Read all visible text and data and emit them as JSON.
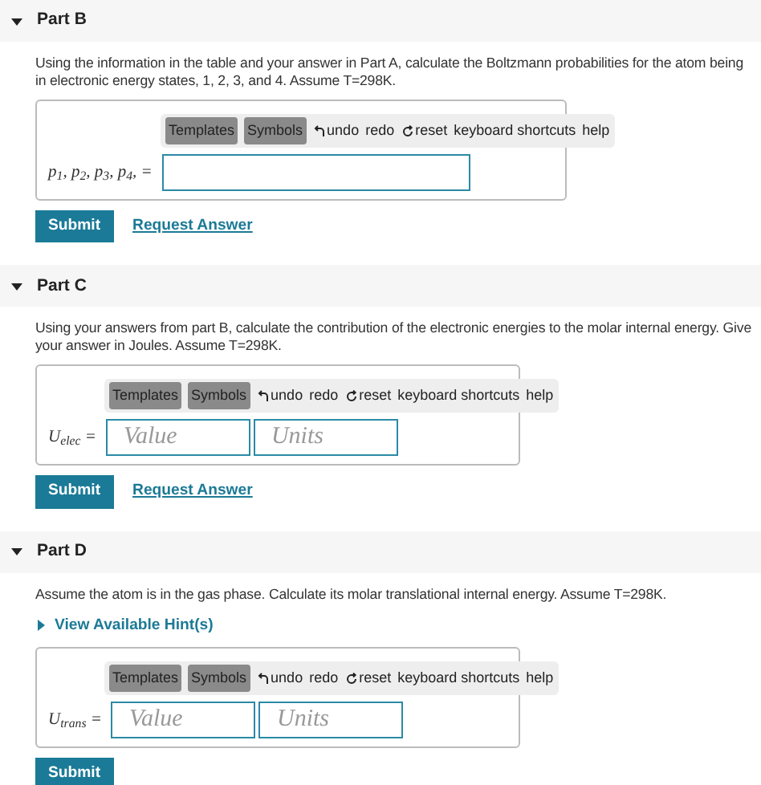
{
  "parts": [
    {
      "title": "Part B",
      "expanded": true,
      "prompt": "Using the information in the table and your answer in Part A, calculate the Boltzmann probabilities for the atom being in electronic energy states, 1, 2, 3, and 4. Assume T=298K.",
      "toolbar": [
        "Templates",
        "Symbols",
        "undo",
        "redo",
        "reset",
        "keyboard shortcuts",
        "help"
      ],
      "label": "p$_{1}$, p$_{2}$, p$_{3}$, p$_{4}$, =",
      "fields": [
        {
          "kind": "wide"
        }
      ],
      "buttons": [
        "Submit",
        "Request Answer"
      ]
    },
    {
      "title": "Part C",
      "expanded": true,
      "prompt": "Using your answers from part B, calculate the contribution of the electronic energies to the molar internal energy. Give your answer in Joules. Assume T=298K.",
      "toolbar": [
        "Templates",
        "Symbols",
        "undo",
        "redo",
        "reset",
        "keyboard shortcuts",
        "help"
      ],
      "label": "U$_{elec}$ =",
      "fields": [
        {
          "kind": "narrow",
          "placeholder": "Value"
        },
        {
          "kind": "narrow",
          "placeholder": "Units"
        }
      ],
      "buttons": [
        "Submit",
        "Request Answer"
      ]
    },
    {
      "title": "Part D",
      "expanded": true,
      "prompt": "Assume the atom is in the gas phase. Calculate its molar translational internal energy. Assume T=298K.",
      "hint": "View Available Hint(s)",
      "toolbar": [
        "Templates",
        "Symbols",
        "undo",
        "redo",
        "reset",
        "keyboard shortcuts",
        "help"
      ],
      "label": "U$_{trans}$ =",
      "fields": [
        {
          "kind": "narrow",
          "placeholder": "Value"
        },
        {
          "kind": "narrow",
          "placeholder": "Units"
        }
      ],
      "buttons": [
        "Submit"
      ]
    }
  ]
}
